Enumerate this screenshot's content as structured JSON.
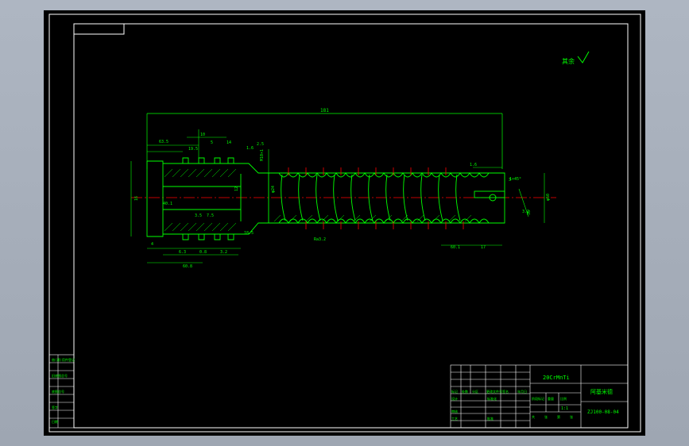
{
  "drawing": {
    "title_block": {
      "part_name": "阿基米德",
      "material": "20CrMnTi",
      "drawing_no": "ZJ100-08-04",
      "scale": "1:1",
      "header_labels": [
        "标记",
        "处数",
        "分区",
        "更改文件号",
        "签名",
        "年月日"
      ],
      "role_labels": [
        "设计",
        "标准化",
        "审核",
        "工艺",
        "批准"
      ],
      "stage_labels": [
        "阶段标记",
        "重量",
        "比例"
      ],
      "sheet_labels": [
        "共",
        "张",
        "第",
        "张"
      ]
    },
    "surface_finish_note": "其余",
    "left_strip_labels": [
      "借(通)用件登记",
      "旧底图总号",
      "底图总号",
      "签字",
      "日期"
    ],
    "dims": {
      "overall_length": "181",
      "d1": "63.5",
      "d2": "19.5",
      "d3": "10",
      "d4": "5",
      "d5": "14",
      "d6": "1.6",
      "d7": "2.5",
      "d8": "M10×1",
      "d9": "16",
      "d10": "12",
      "d11": "4",
      "d12": "6.3",
      "d13": "0.8",
      "d14": "3.2",
      "d15": "18.5",
      "d16": "40.1",
      "d17": "60.8",
      "d18": "3.5",
      "d19": "7.5",
      "d20": "60.1",
      "d21": "17",
      "d22": "1.6",
      "d23": "φ50",
      "d24": "3.2",
      "d25": "φ24",
      "d26": "Ra3.2",
      "d27": "35",
      "d28": "3",
      "d29": "1×45°"
    }
  }
}
